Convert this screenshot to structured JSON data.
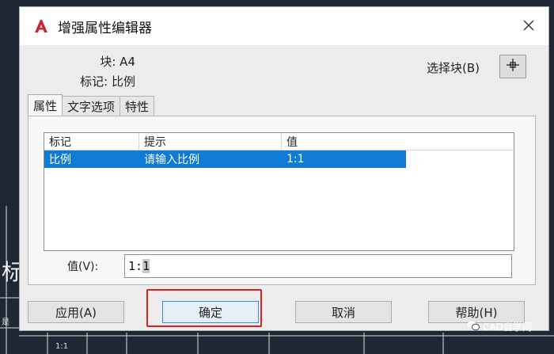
{
  "background": {
    "left_char": "标",
    "bottom_value": "1:1",
    "small_text": "是"
  },
  "dialog": {
    "title": "增强属性编辑器",
    "block_label": "块: A4",
    "tag_label": "标记: 比例",
    "select_block_label": "选择块(B)",
    "tabs": [
      {
        "label": "属性",
        "active": true
      },
      {
        "label": "文字选项",
        "active": false
      },
      {
        "label": "特性",
        "active": false
      }
    ],
    "table": {
      "headers": [
        "标记",
        "提示",
        "值"
      ],
      "rows": [
        {
          "tag": "比例",
          "prompt": "请输入比例",
          "value": "1:1",
          "selected": true
        }
      ]
    },
    "value_field": {
      "label": "值(V):",
      "value_prefix": "1:",
      "value_selected": "1"
    },
    "buttons": {
      "apply": "应用(A)",
      "ok": "确定",
      "cancel": "取消",
      "help": "帮助(H)"
    }
  },
  "watermark": "CAD自学网",
  "colors": {
    "accent_red": "#e02020",
    "selection_blue": "#0f7bd4",
    "autocad_red": "#c8262b"
  }
}
